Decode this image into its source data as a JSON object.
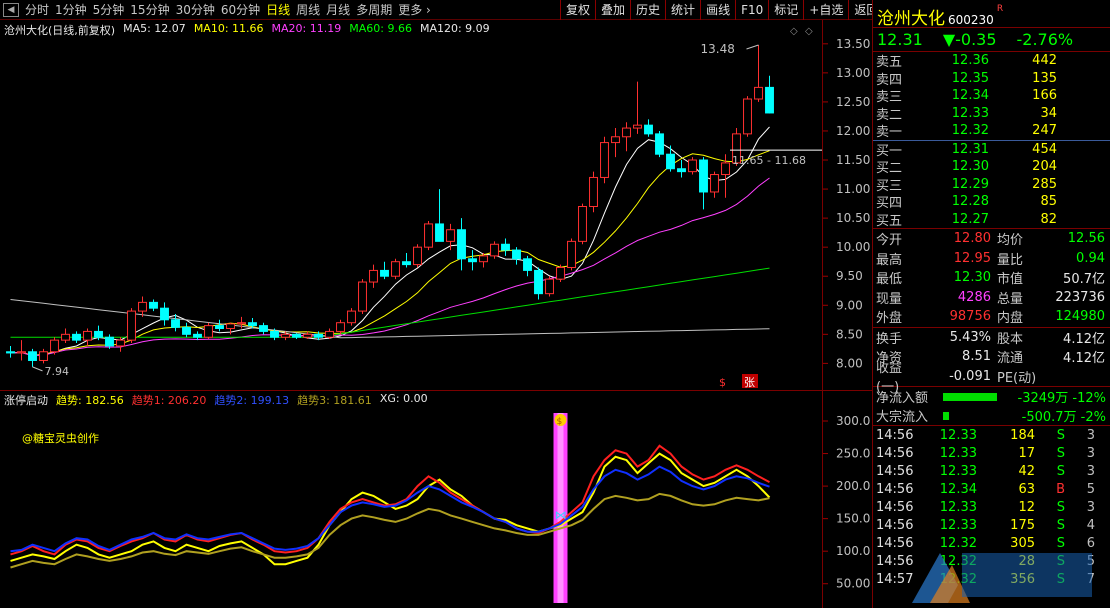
{
  "nav": {
    "tabs": [
      "分时",
      "1分钟",
      "5分钟",
      "15分钟",
      "30分钟",
      "60分钟",
      "日线",
      "周线",
      "月线",
      "多周期",
      "更多"
    ],
    "active_tab": "日线",
    "back_icon": "back-arrow-icon"
  },
  "toolbar": [
    "复权",
    "叠加",
    "历史",
    "统计",
    "画线",
    "F10",
    "标记",
    "+自选",
    "返回"
  ],
  "main_legend": {
    "title": "沧州大化(日线,前复权)",
    "ma5": "MA5: 12.07",
    "ma10": "MA10: 11.66",
    "ma20": "MA20: 11.19",
    "ma60": "MA60: 9.66",
    "ma120": "MA120: 9.09"
  },
  "sub_legend": {
    "title": "涨停启动",
    "s1": "趋势: 182.56",
    "s2": "趋势1: 206.20",
    "s3": "趋势2: 199.13",
    "s4": "趋势3: 181.61",
    "xg": "XG: 0.00"
  },
  "credit": "@糖宝灵虫创作",
  "annotations": {
    "high": "13.48",
    "level": "11.65 - 11.68",
    "low": "7.94",
    "marker_s": "$",
    "marker_zhang": "张"
  },
  "colors": {
    "up": "#ff3030",
    "down": "#00ffff",
    "ma5": "#ffffff",
    "ma10": "#ffff00",
    "ma20": "#ff40ff",
    "ma60": "#00dd00",
    "ma120": "#c0c0c0"
  },
  "right": {
    "name": "沧州大化",
    "code": "600230",
    "flag": "R",
    "price": "12.31",
    "change": "▼-0.35",
    "pct": "-2.76%",
    "asks": [
      {
        "label": "卖五",
        "price": "12.36",
        "vol": "442"
      },
      {
        "label": "卖四",
        "price": "12.35",
        "vol": "135"
      },
      {
        "label": "卖三",
        "price": "12.34",
        "vol": "166"
      },
      {
        "label": "卖二",
        "price": "12.33",
        "vol": "34"
      },
      {
        "label": "卖一",
        "price": "12.32",
        "vol": "247"
      }
    ],
    "bids": [
      {
        "label": "买一",
        "price": "12.31",
        "vol": "454"
      },
      {
        "label": "买二",
        "price": "12.30",
        "vol": "204"
      },
      {
        "label": "买三",
        "price": "12.29",
        "vol": "285"
      },
      {
        "label": "买四",
        "price": "12.28",
        "vol": "85"
      },
      {
        "label": "买五",
        "price": "12.27",
        "vol": "82"
      }
    ],
    "stats1": [
      {
        "k": "今开",
        "v": "12.80",
        "vc": "c-red",
        "k2": "均价",
        "v2": "12.56",
        "v2c": "c-green"
      },
      {
        "k": "最高",
        "v": "12.95",
        "vc": "c-red",
        "k2": "量比",
        "v2": "0.94",
        "v2c": "c-green"
      },
      {
        "k": "最低",
        "v": "12.30",
        "vc": "c-green",
        "k2": "市值",
        "v2": "50.7亿",
        "v2c": "c-white"
      },
      {
        "k": "现量",
        "v": "4286",
        "vc": "c-mag",
        "k2": "总量",
        "v2": "223736",
        "v2c": "c-white"
      },
      {
        "k": "外盘",
        "v": "98756",
        "vc": "c-red",
        "k2": "内盘",
        "v2": "124980",
        "v2c": "c-green"
      }
    ],
    "stats2": [
      {
        "k": "换手",
        "v": "5.43%",
        "vc": "c-white",
        "k2": "股本",
        "v2": "4.12亿",
        "v2c": "c-white"
      },
      {
        "k": "净资",
        "v": "8.51",
        "vc": "c-white",
        "k2": "流通",
        "v2": "4.12亿",
        "v2c": "c-white"
      },
      {
        "k": "收益(一)",
        "v": "-0.091",
        "vc": "c-white",
        "k2": "PE(动)",
        "v2": "",
        "v2c": "c-white"
      }
    ],
    "flows": [
      {
        "k": "净流入额",
        "bar": 54,
        "v": "-3249万  -12%"
      },
      {
        "k": "大宗流入",
        "bar": 6,
        "v": "-500.7万  -2%"
      }
    ],
    "ticks": [
      {
        "t": "14:56",
        "p": "12.33",
        "q": "184",
        "s": "S",
        "n": "3"
      },
      {
        "t": "14:56",
        "p": "12.33",
        "q": "17",
        "s": "S",
        "n": "3"
      },
      {
        "t": "14:56",
        "p": "12.33",
        "q": "42",
        "s": "S",
        "n": "3"
      },
      {
        "t": "14:56",
        "p": "12.34",
        "q": "63",
        "s": "B",
        "n": "5"
      },
      {
        "t": "14:56",
        "p": "12.33",
        "q": "12",
        "s": "S",
        "n": "3"
      },
      {
        "t": "14:56",
        "p": "12.33",
        "q": "175",
        "s": "S",
        "n": "4"
      },
      {
        "t": "14:56",
        "p": "12.32",
        "q": "305",
        "s": "S",
        "n": "6"
      },
      {
        "t": "14:56",
        "p": "12.32",
        "q": "28",
        "s": "S",
        "n": "5"
      },
      {
        "t": "14:57",
        "p": "12.32",
        "q": "356",
        "s": "S",
        "n": "7"
      }
    ]
  },
  "chart_data": [
    {
      "type": "candlestick",
      "title": "沧州大化(日线,前复权)",
      "ylim": [
        7.8,
        13.6
      ],
      "yticks": [
        "13.50",
        "13.00",
        "12.50",
        "12.00",
        "11.50",
        "11.00",
        "10.50",
        "10.00",
        "9.50",
        "9.00",
        "8.50",
        "8.00"
      ],
      "ohlc": [
        [
          8.2,
          8.3,
          8.1,
          8.18
        ],
        [
          8.18,
          8.4,
          8.05,
          8.2
        ],
        [
          8.2,
          8.25,
          7.94,
          8.05
        ],
        [
          8.05,
          8.25,
          8.0,
          8.2
        ],
        [
          8.2,
          8.45,
          8.15,
          8.4
        ],
        [
          8.4,
          8.6,
          8.35,
          8.5
        ],
        [
          8.5,
          8.55,
          8.35,
          8.4
        ],
        [
          8.4,
          8.6,
          8.3,
          8.55
        ],
        [
          8.55,
          8.65,
          8.4,
          8.45
        ],
        [
          8.45,
          8.5,
          8.25,
          8.3
        ],
        [
          8.3,
          8.45,
          8.2,
          8.4
        ],
        [
          8.4,
          8.95,
          8.35,
          8.9
        ],
        [
          8.9,
          9.15,
          8.8,
          9.05
        ],
        [
          9.05,
          9.1,
          8.9,
          8.95
        ],
        [
          8.95,
          9.05,
          8.65,
          8.75
        ],
        [
          8.75,
          8.85,
          8.55,
          8.62
        ],
        [
          8.62,
          8.7,
          8.45,
          8.5
        ],
        [
          8.5,
          8.55,
          8.4,
          8.45
        ],
        [
          8.45,
          8.7,
          8.42,
          8.65
        ],
        [
          8.65,
          8.75,
          8.55,
          8.6
        ],
        [
          8.6,
          8.7,
          8.5,
          8.68
        ],
        [
          8.68,
          8.8,
          8.6,
          8.7
        ],
        [
          8.7,
          8.78,
          8.6,
          8.65
        ],
        [
          8.65,
          8.7,
          8.5,
          8.55
        ],
        [
          8.55,
          8.6,
          8.4,
          8.45
        ],
        [
          8.45,
          8.55,
          8.4,
          8.5
        ],
        [
          8.5,
          8.52,
          8.42,
          8.45
        ],
        [
          8.45,
          8.55,
          8.42,
          8.5
        ],
        [
          8.5,
          8.55,
          8.4,
          8.45
        ],
        [
          8.45,
          8.6,
          8.42,
          8.55
        ],
        [
          8.55,
          8.75,
          8.5,
          8.7
        ],
        [
          8.7,
          8.95,
          8.65,
          8.9
        ],
        [
          8.9,
          9.45,
          8.85,
          9.4
        ],
        [
          9.4,
          9.7,
          9.3,
          9.6
        ],
        [
          9.6,
          9.75,
          9.45,
          9.5
        ],
        [
          9.5,
          9.8,
          9.45,
          9.75
        ],
        [
          9.75,
          9.9,
          9.65,
          9.7
        ],
        [
          9.7,
          10.05,
          9.65,
          10.0
        ],
        [
          10.0,
          10.45,
          9.95,
          10.4
        ],
        [
          10.4,
          11.0,
          10.35,
          10.1
        ],
        [
          10.1,
          10.4,
          9.95,
          10.3
        ],
        [
          10.3,
          10.5,
          9.6,
          9.8
        ],
        [
          9.8,
          9.95,
          9.6,
          9.75
        ],
        [
          9.75,
          9.9,
          9.65,
          9.85
        ],
        [
          9.85,
          10.1,
          9.8,
          10.05
        ],
        [
          10.05,
          10.15,
          9.85,
          9.95
        ],
        [
          9.95,
          10.0,
          9.7,
          9.8
        ],
        [
          9.8,
          9.85,
          9.5,
          9.6
        ],
        [
          9.6,
          9.65,
          9.1,
          9.2
        ],
        [
          9.2,
          9.5,
          9.15,
          9.45
        ],
        [
          9.45,
          9.7,
          9.4,
          9.65
        ],
        [
          9.65,
          10.15,
          9.6,
          10.1
        ],
        [
          10.1,
          10.75,
          10.05,
          10.7
        ],
        [
          10.7,
          11.3,
          10.6,
          11.2
        ],
        [
          11.2,
          11.9,
          11.1,
          11.8
        ],
        [
          11.8,
          12.05,
          11.55,
          11.9
        ],
        [
          11.9,
          12.15,
          11.65,
          12.05
        ],
        [
          12.05,
          12.85,
          11.95,
          12.1
        ],
        [
          12.1,
          12.2,
          11.9,
          11.95
        ],
        [
          11.95,
          12.0,
          11.55,
          11.6
        ],
        [
          11.6,
          11.75,
          11.3,
          11.35
        ],
        [
          11.35,
          11.5,
          11.2,
          11.3
        ],
        [
          11.3,
          11.55,
          11.25,
          11.5
        ],
        [
          11.5,
          11.55,
          10.65,
          10.95
        ],
        [
          10.95,
          11.3,
          10.85,
          11.25
        ],
        [
          11.25,
          11.6,
          10.85,
          11.45
        ],
        [
          11.45,
          12.05,
          11.4,
          11.95
        ],
        [
          11.95,
          12.6,
          11.9,
          12.55
        ],
        [
          12.55,
          13.48,
          12.5,
          12.75
        ],
        [
          12.75,
          12.95,
          12.3,
          12.31
        ]
      ],
      "ma_series": [
        {
          "name": "MA5",
          "last": 12.07
        },
        {
          "name": "MA10",
          "last": 11.66
        },
        {
          "name": "MA20",
          "last": 11.19
        },
        {
          "name": "MA60",
          "last": 9.66
        },
        {
          "name": "MA120",
          "last": 9.09
        }
      ]
    },
    {
      "type": "line",
      "title": "涨停启动",
      "ylim": [
        25,
        320
      ],
      "yticks": [
        "300.0",
        "250.0",
        "200.0",
        "150.0",
        "100.0",
        "50.00"
      ],
      "series": [
        {
          "name": "趋势",
          "color": "#ffff00",
          "values": [
            85,
            90,
            95,
            92,
            88,
            100,
            110,
            105,
            95,
            90,
            95,
            100,
            110,
            115,
            105,
            100,
            110,
            105,
            100,
            108,
            112,
            115,
            105,
            95,
            80,
            80,
            85,
            90,
            110,
            140,
            160,
            180,
            190,
            185,
            175,
            165,
            170,
            180,
            200,
            210,
            195,
            185,
            170,
            160,
            150,
            148,
            140,
            135,
            130,
            135,
            140,
            150,
            160,
            190,
            230,
            245,
            240,
            220,
            235,
            250,
            240,
            220,
            210,
            200,
            205,
            215,
            225,
            215,
            200,
            182.56
          ]
        },
        {
          "name": "趋势1",
          "color": "#ff2020",
          "values": [
            95,
            100,
            108,
            100,
            95,
            110,
            118,
            115,
            105,
            100,
            108,
            115,
            120,
            128,
            118,
            115,
            125,
            118,
            115,
            120,
            125,
            128,
            118,
            110,
            100,
            98,
            100,
            105,
            120,
            145,
            165,
            175,
            180,
            175,
            170,
            172,
            180,
            200,
            215,
            205,
            190,
            180,
            170,
            160,
            150,
            145,
            135,
            130,
            128,
            135,
            145,
            160,
            175,
            215,
            240,
            255,
            250,
            230,
            240,
            262,
            250,
            230,
            218,
            210,
            215,
            225,
            232,
            225,
            215,
            206.2
          ]
        },
        {
          "name": "趋势2",
          "color": "#1030ff",
          "values": [
            100,
            102,
            110,
            105,
            100,
            112,
            120,
            118,
            108,
            102,
            110,
            118,
            122,
            128,
            120,
            118,
            126,
            120,
            118,
            122,
            126,
            128,
            120,
            112,
            104,
            102,
            104,
            108,
            120,
            140,
            160,
            170,
            175,
            172,
            168,
            170,
            178,
            190,
            200,
            195,
            185,
            175,
            168,
            160,
            150,
            145,
            135,
            130,
            130,
            135,
            142,
            155,
            168,
            195,
            215,
            225,
            220,
            210,
            218,
            230,
            222,
            208,
            200,
            195,
            200,
            210,
            215,
            212,
            205,
            199.13
          ]
        },
        {
          "name": "趋势3",
          "color": "#b0a020",
          "values": [
            75,
            80,
            85,
            82,
            80,
            88,
            95,
            92,
            88,
            85,
            88,
            92,
            98,
            100,
            96,
            94,
            100,
            98,
            96,
            100,
            104,
            106,
            100,
            95,
            90,
            90,
            92,
            95,
            105,
            125,
            140,
            150,
            155,
            152,
            148,
            145,
            150,
            158,
            165,
            162,
            155,
            150,
            145,
            140,
            135,
            132,
            128,
            125,
            125,
            130,
            135,
            140,
            148,
            165,
            180,
            185,
            182,
            178,
            180,
            188,
            185,
            178,
            172,
            170,
            172,
            178,
            182,
            180,
            178,
            181.61
          ]
        }
      ]
    }
  ]
}
